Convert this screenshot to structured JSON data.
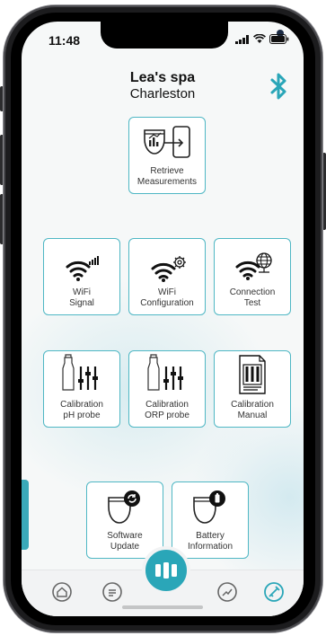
{
  "status": {
    "time": "11:48"
  },
  "header": {
    "title": "Lea's spa",
    "subtitle": "Charleston"
  },
  "tiles": {
    "retrieve": {
      "line1": "Retrieve",
      "line2": "Measurements",
      "icon": "retrieve-measurements-icon"
    },
    "wifi_signal": {
      "line1": "WiFi",
      "line2": "Signal",
      "icon": "wifi-signal-icon"
    },
    "wifi_config": {
      "line1": "WiFi",
      "line2": "Configuration",
      "icon": "wifi-configuration-icon"
    },
    "conn_test": {
      "line1": "Connection",
      "line2": "Test",
      "icon": "connection-test-icon"
    },
    "cal_ph": {
      "line1": "Calibration",
      "line2": "pH probe",
      "icon": "calibration-ph-icon"
    },
    "cal_orp": {
      "line1": "Calibration",
      "line2": "ORP probe",
      "icon": "calibration-orp-icon"
    },
    "cal_manual": {
      "line1": "Calibration",
      "line2": "Manual",
      "icon": "calibration-manual-icon"
    },
    "sw_update": {
      "line1": "Software",
      "line2": "Update",
      "icon": "software-update-icon"
    },
    "battery": {
      "line1": "Battery",
      "line2": "Information",
      "icon": "battery-information-icon"
    }
  },
  "nav": [
    "home-icon",
    "messages-icon",
    "device-icon",
    "gauge-icon",
    "tools-icon"
  ],
  "colors": {
    "accent": "#2aa6b8",
    "tile_border": "#4fb7c4",
    "bluetooth": "#2aa6b8"
  }
}
